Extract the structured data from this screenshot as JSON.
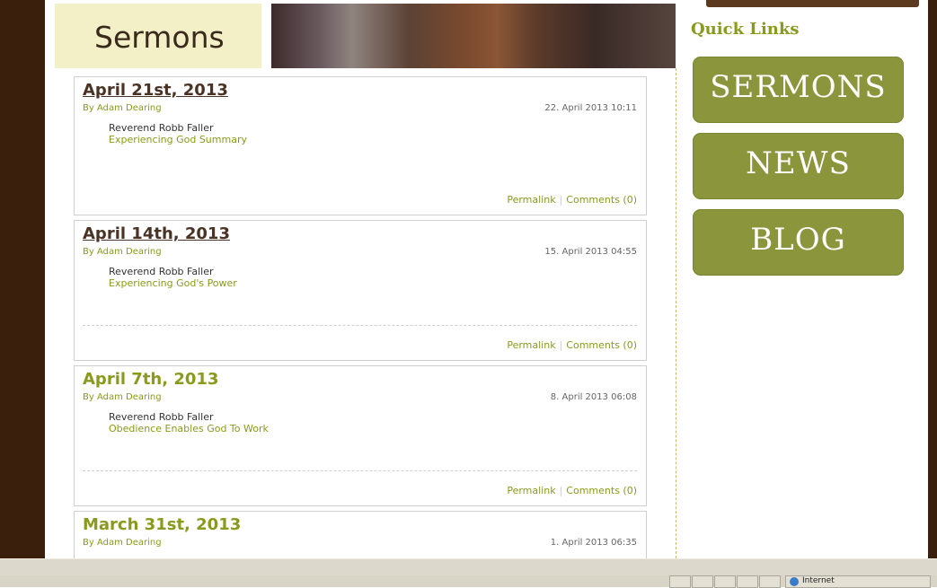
{
  "page": {
    "section_title": "Sermons"
  },
  "posts": [
    {
      "title": "April 21st, 2013",
      "author": "By Adam Dearing",
      "date": "22. April 2013 10:11",
      "speaker": "Reverend Robb Faller",
      "subject": "Experiencing God Summary",
      "permalink_label": "Permalink",
      "comments_label": "Comments (0)"
    },
    {
      "title": "April 14th, 2013",
      "author": "By Adam Dearing",
      "date": "15. April 2013 04:55",
      "speaker": "Reverend Robb Faller",
      "subject": "Experiencing God's Power",
      "permalink_label": "Permalink",
      "comments_label": "Comments (0)"
    },
    {
      "title": "April 7th, 2013",
      "author": "By Adam Dearing",
      "date": "8. April 2013 06:08",
      "speaker": "Reverend Robb Faller",
      "subject": "Obedience Enables God To Work",
      "permalink_label": "Permalink",
      "comments_label": "Comments (0)"
    },
    {
      "title": "March 31st, 2013",
      "author": "By Adam Dearing",
      "date": "1. April 2013 06:35"
    }
  ],
  "sidebar": {
    "heading": "Quick Links",
    "buttons": [
      {
        "label": "SERMONS"
      },
      {
        "label": "NEWS"
      },
      {
        "label": "BLOG"
      }
    ]
  },
  "status_bar": {
    "zone": "Internet",
    "zone_icon": "globe-icon"
  },
  "colors": {
    "frame": "#3a1f0c",
    "accent": "#8a9a1c",
    "button": "#8b953c",
    "header_label_bg": "#f3f0c8"
  }
}
